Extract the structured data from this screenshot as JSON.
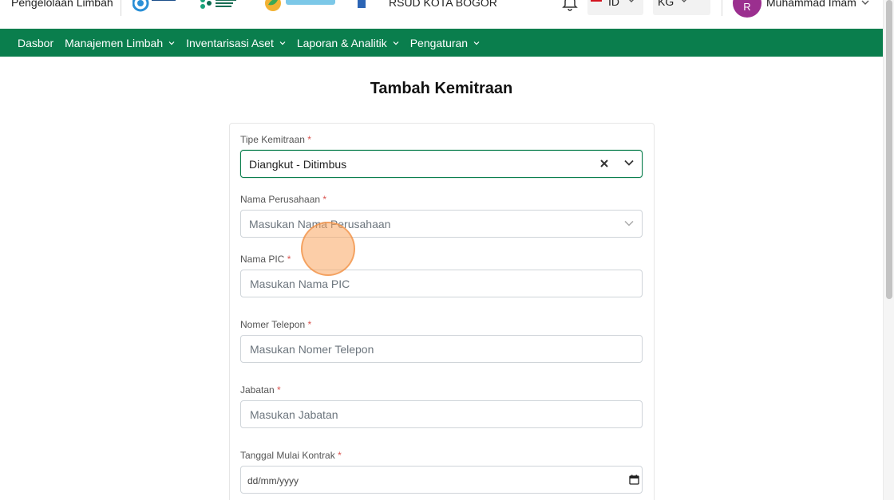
{
  "header": {
    "app_title": "Pengelolaan Limbah",
    "logos": [
      "smile-logo",
      "kemenkes-logo",
      "kesling-logo",
      "hospital-logo"
    ],
    "hospital_name": "RSUD KOTA BOGOR",
    "language": "ID",
    "unit": "KG",
    "user_initial": "R",
    "user_name": "Muhammad Imam"
  },
  "nav": {
    "items": [
      {
        "label": "Dasbor",
        "has_dropdown": false
      },
      {
        "label": "Manajemen Limbah",
        "has_dropdown": true
      },
      {
        "label": "Inventarisasi Aset",
        "has_dropdown": true
      },
      {
        "label": "Laporan & Analitik",
        "has_dropdown": true
      },
      {
        "label": "Pengaturan",
        "has_dropdown": true
      }
    ]
  },
  "form": {
    "title": "Tambah Kemitraan",
    "required_mark": "*",
    "fields": {
      "tipe_kemitraan": {
        "label": "Tipe Kemitraan",
        "value": "Diangkut - Ditimbus"
      },
      "nama_perusahaan": {
        "label": "Nama Perusahaan",
        "placeholder": "Masukan Nama Perusahaan"
      },
      "nama_pic": {
        "label": "Nama PIC",
        "placeholder": "Masukan Nama PIC"
      },
      "nomer_telepon": {
        "label": "Nomer Telepon",
        "placeholder": "Masukan Nomer Telepon"
      },
      "jabatan": {
        "label": "Jabatan",
        "placeholder": "Masukan Jabatan"
      },
      "tanggal_mulai": {
        "label": "Tanggal Mulai Kontrak",
        "placeholder": "dd/mm/yyyy"
      }
    }
  },
  "colors": {
    "brand_green": "#0a7e4d",
    "avatar": "#9b2f8f",
    "required": "#d9534f",
    "cursor_highlight": "#f9a660"
  }
}
